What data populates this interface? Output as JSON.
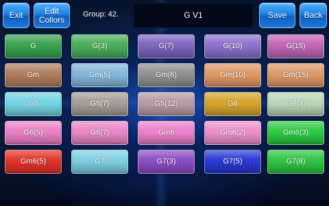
{
  "toolbar": {
    "exit_label": "Exit",
    "edit_colors_label": "Edit\nCollors",
    "group_label": "Group: 42.",
    "name_value": "G V1",
    "save_label": "Save",
    "back_label": "Back"
  },
  "grid": {
    "rows": [
      [
        {
          "label": "G",
          "color": "#2fa24a"
        },
        {
          "label": "G(3)",
          "color": "#3fae52"
        },
        {
          "label": "G(7)",
          "color": "#7a5fc0"
        },
        {
          "label": "G(10)",
          "color": "#8a6cd0"
        },
        {
          "label": "G(15)",
          "color": "#c25fb8"
        }
      ],
      [
        {
          "label": "Gm",
          "color": "#b07a55"
        },
        {
          "label": "Gm(5)",
          "color": "#7fb8e0"
        },
        {
          "label": "Gm(6)",
          "color": "#8e8e8e"
        },
        {
          "label": "Gm(10)",
          "color": "#e6975e"
        },
        {
          "label": "Gm(15)",
          "color": "#e29863"
        }
      ],
      [
        {
          "label": "G5",
          "color": "#6fd7e8"
        },
        {
          "label": "G5(7)",
          "color": "#a69a94"
        },
        {
          "label": "G5(12)",
          "color": "#b89aa4"
        },
        {
          "label": "G6",
          "color": "#d9a520"
        },
        {
          "label": "G6(3)",
          "color": "#b9d9b9"
        }
      ],
      [
        {
          "label": "G6(5)",
          "color": "#f07cc8"
        },
        {
          "label": "G6(7)",
          "color": "#ef82c8"
        },
        {
          "label": "Gm6",
          "color": "#f07ccd"
        },
        {
          "label": "Gm6(2)",
          "color": "#f28ccf"
        },
        {
          "label": "Gm6(3)",
          "color": "#1fcf38"
        }
      ],
      [
        {
          "label": "Gm6(5)",
          "color": "#e8281e"
        },
        {
          "label": "G7",
          "color": "#7ad2e6"
        },
        {
          "label": "G7(3)",
          "color": "#8a44c8"
        },
        {
          "label": "G7(5)",
          "color": "#1f2fd6"
        },
        {
          "label": "G7(8)",
          "color": "#22c83a"
        }
      ]
    ]
  }
}
